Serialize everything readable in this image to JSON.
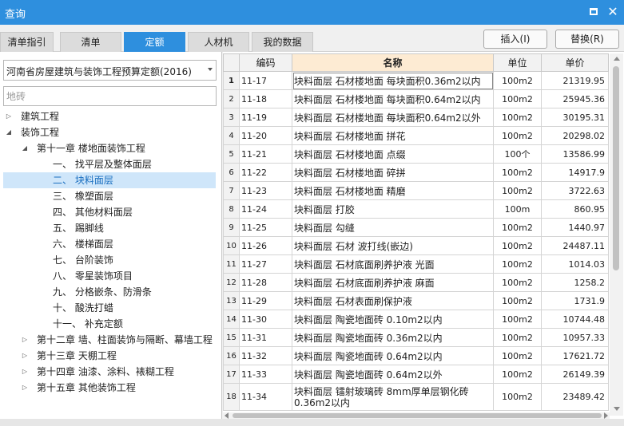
{
  "window": {
    "title": "查询",
    "maximize_icon": "maximize-icon",
    "close_icon": "close-icon"
  },
  "tabs": [
    {
      "label": "清单指引",
      "active": false
    },
    {
      "label": "清单",
      "active": false
    },
    {
      "label": "定额",
      "active": true
    },
    {
      "label": "人材机",
      "active": false
    },
    {
      "label": "我的数据",
      "active": false
    }
  ],
  "actions": {
    "insert": "插入(I)",
    "replace": "替换(R)"
  },
  "filter": {
    "library": "河南省房屋建筑与装饰工程预算定额(2016)",
    "search_value": "",
    "search_placeholder": "地砖"
  },
  "tree": [
    {
      "label": "建筑工程",
      "expanded": false,
      "selected": false
    },
    {
      "label": "装饰工程",
      "expanded": true,
      "selected": false
    },
    {
      "label": "第十一章 楼地面装饰工程",
      "expanded": true,
      "selected": false
    },
    {
      "label": "一、 找平层及整体面层",
      "selected": false
    },
    {
      "label": "二、 块料面层",
      "selected": true
    },
    {
      "label": "三、 橡塑面层",
      "selected": false
    },
    {
      "label": "四、 其他材料面层",
      "selected": false
    },
    {
      "label": "五、 踢脚线",
      "selected": false
    },
    {
      "label": "六、 楼梯面层",
      "selected": false
    },
    {
      "label": "七、 台阶装饰",
      "selected": false
    },
    {
      "label": "八、 零星装饰项目",
      "selected": false
    },
    {
      "label": "九、 分格嵌条、防滑条",
      "selected": false
    },
    {
      "label": "十、 酸洗打蜡",
      "selected": false
    },
    {
      "label": "十一、 补充定额",
      "selected": false
    },
    {
      "label": "第十二章 墙、柱面装饰与隔断、幕墙工程",
      "expanded": false,
      "selected": false
    },
    {
      "label": "第十三章 天棚工程",
      "expanded": false,
      "selected": false
    },
    {
      "label": "第十四章 油漆、涂料、裱糊工程",
      "expanded": false,
      "selected": false
    },
    {
      "label": "第十五章 其他装饰工程",
      "expanded": false,
      "selected": false
    }
  ],
  "table": {
    "columns": {
      "index": "",
      "code": "编码",
      "name": "名称",
      "unit": "单位",
      "price": "单价"
    },
    "rows": [
      {
        "idx": "1",
        "code": "11-17",
        "name": "块料面层 石材楼地面 每块面积0.36m2以内",
        "unit": "100m2",
        "price": "21319.95"
      },
      {
        "idx": "2",
        "code": "11-18",
        "name": "块料面层 石材楼地面 每块面积0.64m2以内",
        "unit": "100m2",
        "price": "25945.36"
      },
      {
        "idx": "3",
        "code": "11-19",
        "name": "块料面层 石材楼地面 每块面积0.64m2以外",
        "unit": "100m2",
        "price": "30195.31"
      },
      {
        "idx": "4",
        "code": "11-20",
        "name": "块料面层 石材楼地面 拼花",
        "unit": "100m2",
        "price": "20298.02"
      },
      {
        "idx": "5",
        "code": "11-21",
        "name": "块料面层 石材楼地面 点缀",
        "unit": "100个",
        "price": "13586.99"
      },
      {
        "idx": "6",
        "code": "11-22",
        "name": "块料面层 石材楼地面 碎拼",
        "unit": "100m2",
        "price": "14917.9"
      },
      {
        "idx": "7",
        "code": "11-23",
        "name": "块料面层 石材楼地面 精磨",
        "unit": "100m2",
        "price": "3722.63"
      },
      {
        "idx": "8",
        "code": "11-24",
        "name": "块料面层 打胶",
        "unit": "100m",
        "price": "860.95"
      },
      {
        "idx": "9",
        "code": "11-25",
        "name": "块料面层 勾缝",
        "unit": "100m2",
        "price": "1440.97"
      },
      {
        "idx": "10",
        "code": "11-26",
        "name": "块料面层 石材 波打线(嵌边)",
        "unit": "100m2",
        "price": "24487.11"
      },
      {
        "idx": "11",
        "code": "11-27",
        "name": "块料面层 石材底面刷养护液 光面",
        "unit": "100m2",
        "price": "1014.03"
      },
      {
        "idx": "12",
        "code": "11-28",
        "name": "块料面层 石材底面刷养护液 麻面",
        "unit": "100m2",
        "price": "1258.2"
      },
      {
        "idx": "13",
        "code": "11-29",
        "name": "块料面层 石材表面刷保护液",
        "unit": "100m2",
        "price": "1731.9"
      },
      {
        "idx": "14",
        "code": "11-30",
        "name": "块料面层 陶瓷地面砖 0.10m2以内",
        "unit": "100m2",
        "price": "10744.48"
      },
      {
        "idx": "15",
        "code": "11-31",
        "name": "块料面层 陶瓷地面砖 0.36m2以内",
        "unit": "100m2",
        "price": "10957.33"
      },
      {
        "idx": "16",
        "code": "11-32",
        "name": "块料面层 陶瓷地面砖 0.64m2以内",
        "unit": "100m2",
        "price": "17621.72"
      },
      {
        "idx": "17",
        "code": "11-33",
        "name": "块料面层 陶瓷地面砖 0.64m2以外",
        "unit": "100m2",
        "price": "26149.39"
      },
      {
        "idx": "18",
        "code": "11-34",
        "name": "块料面层 镭射玻璃砖 8mm厚单层钢化砖 0.36m2以内",
        "unit": "100m2",
        "price": "23489.42"
      }
    ]
  }
}
